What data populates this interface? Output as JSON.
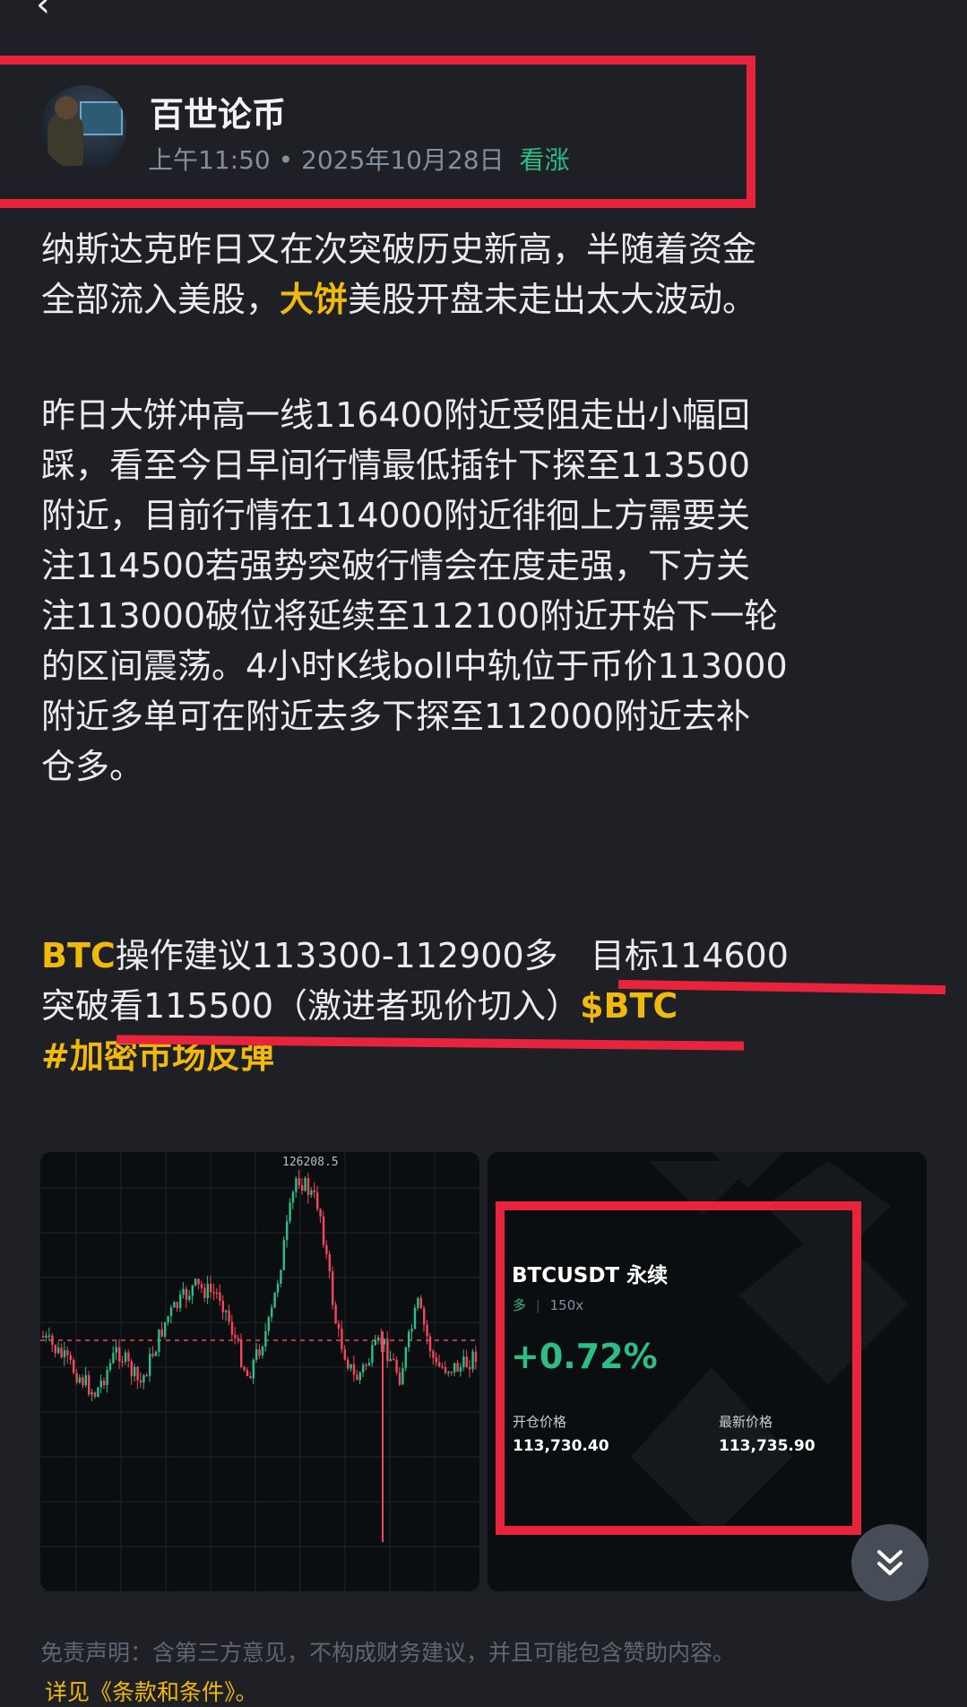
{
  "nav": {
    "back_icon": "chevron-left-icon"
  },
  "post": {
    "author": "百世论币",
    "time": "上午11:50",
    "date": "• 2025年10月28日",
    "sentiment": "看涨",
    "para1_a": "纳斯达克昨日又在次突破历史新高，半随着资金",
    "para1_b_pre": "全部流入美股，",
    "para1_b_hl": "大饼",
    "para1_b_post": "美股开盘未走出太大波动。",
    "para2_lines": [
      "昨日大饼冲高一线116400附近受阻走出小幅回",
      "踩，看至今日早间行情最低插针下探至113500",
      "附近，目前行情在114000附近徘徊上方需要关",
      "注114500若强势突破行情会在度走强，下方关",
      "注113000破位将延续至112100附近开始下一轮",
      "的区间震荡。4小时K线boll中轨位于币价113000",
      "附近多单可在附近去多下探至112000附近去补",
      "仓多。"
    ],
    "sugg_tag": "BTC",
    "sugg_text": "操作建议113300-112900多   目标114600",
    "sugg_line2": "突破看115500（激进者现价切入）",
    "cashtag": "$BTC",
    "hashtag": "#加密市场反弹"
  },
  "chart_card": {
    "peak_label": "126208.5"
  },
  "position_card": {
    "symbol": "BTCUSDT 永续",
    "side": "多",
    "separator": "|",
    "leverage": "150x",
    "pnl": "+0.72%",
    "entry_label": "开仓价格",
    "entry_value": "113,730.40",
    "last_label": "最新价格",
    "last_value": "113,735.90"
  },
  "footer": {
    "disclaimer": "免责声明：含第三方意见，不构成财务建议，并且可能包含赞助内容。",
    "terms": "详见《条款和条件》。"
  },
  "colors": {
    "background": "#1e2026",
    "accent": "#f0b90b",
    "bullish": "#2ebd85",
    "bearish": "#f6465d",
    "annotation_red": "#e8233c"
  }
}
